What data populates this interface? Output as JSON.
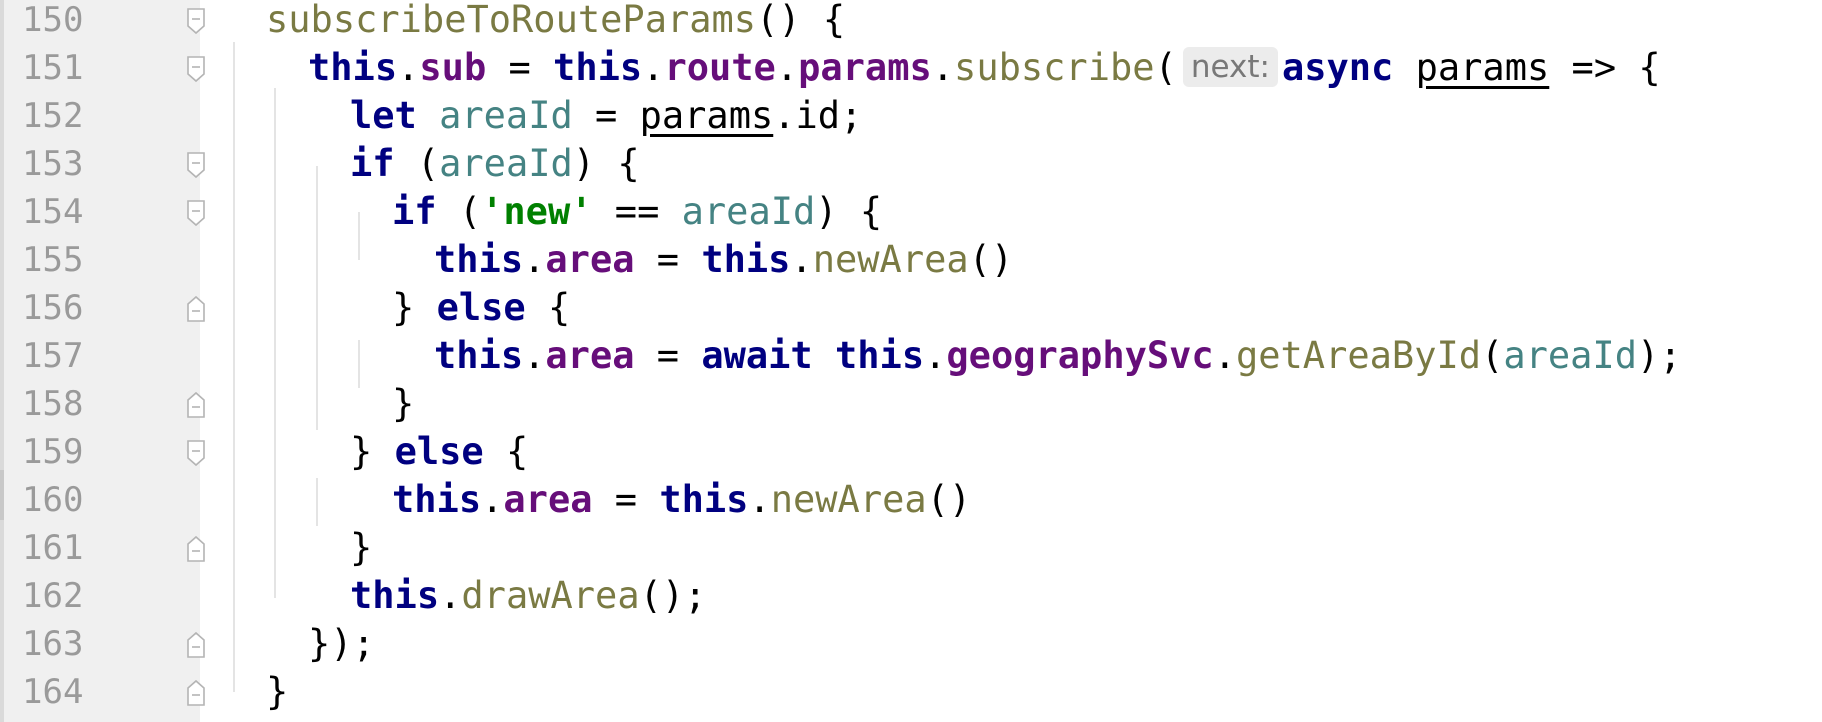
{
  "editor": {
    "lines": [
      {
        "number": "150",
        "fold": "open"
      },
      {
        "number": "151",
        "fold": "open"
      },
      {
        "number": "152",
        "fold": ""
      },
      {
        "number": "153",
        "fold": "open"
      },
      {
        "number": "154",
        "fold": "open"
      },
      {
        "number": "155",
        "fold": ""
      },
      {
        "number": "156",
        "fold": "close"
      },
      {
        "number": "157",
        "fold": ""
      },
      {
        "number": "158",
        "fold": "close"
      },
      {
        "number": "159",
        "fold": "open"
      },
      {
        "number": "160",
        "fold": ""
      },
      {
        "number": "161",
        "fold": "close"
      },
      {
        "number": "162",
        "fold": ""
      },
      {
        "number": "163",
        "fold": "close"
      },
      {
        "number": "164",
        "fold": "close"
      }
    ],
    "code": {
      "l150": {
        "name": "subscribeToRouteParams",
        "rest": "() {"
      },
      "l151": {
        "this1": "this",
        "dot1": ".",
        "sub": "sub",
        "eq": " = ",
        "this2": "this",
        "dot2": ".",
        "route": "route",
        "dot3": ".",
        "params": "params",
        "dot4": ".",
        "subscribe": "subscribe",
        "paren": "(",
        "hint": "next:",
        "async": "async",
        "sp": " ",
        "param": "params",
        "arrow": " => {"
      },
      "l152": {
        "let": "let",
        "sp": " ",
        "var": "areaId",
        "eq": " = ",
        "params": "params",
        "rest": ".id;"
      },
      "l153": {
        "if": "if",
        "open": " (",
        "var": "areaId",
        "close": ") {"
      },
      "l154": {
        "if": "if",
        "open": " (",
        "str": "'new'",
        "eq": " == ",
        "var": "areaId",
        "close": ") {"
      },
      "l155": {
        "this": "this",
        "dot": ".",
        "area": "area",
        "eq": " = ",
        "this2": "this",
        "dot2": ".",
        "fn": "newArea",
        "rest": "()"
      },
      "l156": {
        "brace": "} ",
        "else": "else",
        "rest": " {"
      },
      "l157": {
        "this": "this",
        "dot": ".",
        "area": "area",
        "eq": " = ",
        "await": "await",
        "sp": " ",
        "this2": "this",
        "dot2": ".",
        "svc": "geographySvc",
        "dot3": ".",
        "fn": "getAreaById",
        "open": "(",
        "var": "areaId",
        "close": ");"
      },
      "l158": {
        "brace": "}"
      },
      "l159": {
        "brace": "} ",
        "else": "else",
        "rest": " {"
      },
      "l160": {
        "this": "this",
        "dot": ".",
        "area": "area",
        "eq": " = ",
        "this2": "this",
        "dot2": ".",
        "fn": "newArea",
        "rest": "()"
      },
      "l161": {
        "brace": "}"
      },
      "l162": {
        "this": "this",
        "dot": ".",
        "fn": "drawArea",
        "rest": "();"
      },
      "l163": {
        "rest": "});"
      },
      "l164": {
        "rest": "}"
      }
    },
    "colors": {
      "keyword": "#000080",
      "function": "#7a7a43",
      "field": "#660e7a",
      "variable": "#458383",
      "string": "#008000",
      "line_number": "#9a9a9a",
      "gutter_bg": "#f0f0f0"
    }
  }
}
